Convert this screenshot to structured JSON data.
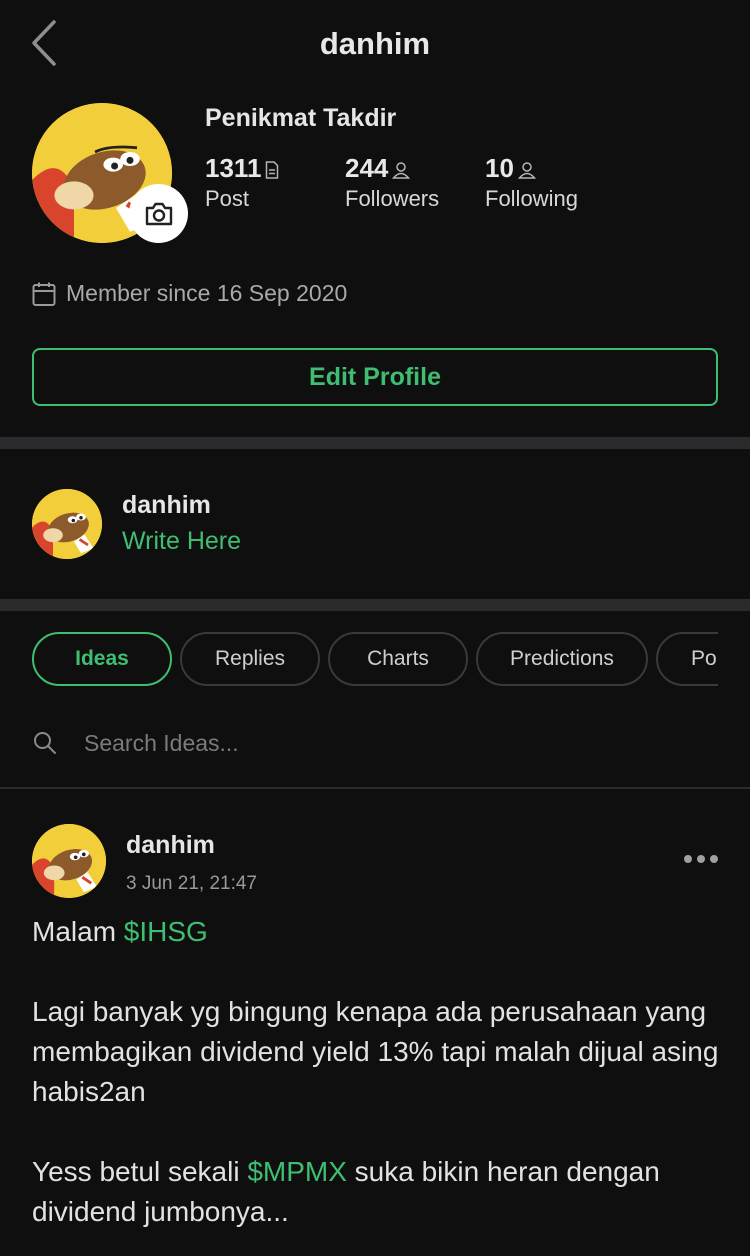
{
  "header": {
    "title": "danhim"
  },
  "profile": {
    "display_name": "Penikmat Takdir",
    "stats": [
      {
        "value": "1311",
        "label": "Post",
        "icon": "document-icon"
      },
      {
        "value": "244",
        "label": "Followers",
        "icon": "person-icon"
      },
      {
        "value": "10",
        "label": "Following",
        "icon": "person-icon"
      }
    ],
    "member_since": "Member since 16 Sep 2020",
    "edit_button": "Edit Profile"
  },
  "compose": {
    "username": "danhim",
    "placeholder": "Write Here"
  },
  "tabs": [
    {
      "label": "Ideas",
      "active": true
    },
    {
      "label": "Replies",
      "active": false
    },
    {
      "label": "Charts",
      "active": false
    },
    {
      "label": "Predictions",
      "active": false
    },
    {
      "label": "Po",
      "active": false
    }
  ],
  "search": {
    "placeholder": "Search Ideas..."
  },
  "post": {
    "author": "danhim",
    "timestamp": "3 Jun 21, 21:47",
    "line1_prefix": "Malam ",
    "line1_tag": "$IHSG",
    "paragraph2": "Lagi banyak yg bingung kenapa ada perusahaan yang membagikan dividend yield 13% tapi malah dijual asing habis2an",
    "line3_prefix": "Yess betul sekali ",
    "line3_tag": "$MPMX",
    "line3_suffix": " suka bikin heran dengan dividend jumbonya..."
  },
  "colors": {
    "accent": "#3fbe72",
    "background": "#0f0f10",
    "divider": "#2b2b2d"
  }
}
